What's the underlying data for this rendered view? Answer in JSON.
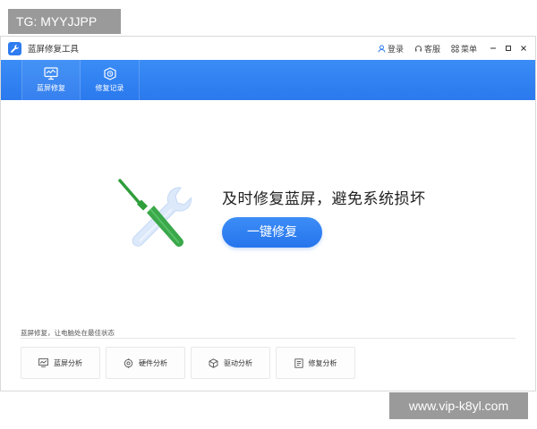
{
  "watermarks": {
    "top": "TG: MYYJJPP",
    "bottom": "www.vip-k8yl.com"
  },
  "app": {
    "title": "蓝屏修复工具",
    "login": "登录",
    "service": "客服",
    "menu": "菜单"
  },
  "nav": {
    "tabs": [
      {
        "label": "蓝屏修复",
        "icon": "monitor-icon"
      },
      {
        "label": "修复记录",
        "icon": "record-icon"
      }
    ]
  },
  "hero": {
    "headline": "及时修复蓝屏，避免系统损坏",
    "button": "一键修复"
  },
  "footer": {
    "label": "蓝屏修复，让电脑处在最佳状态",
    "cards": [
      {
        "label": "蓝屏分析",
        "icon": "chart-icon"
      },
      {
        "label": "硬件分析",
        "icon": "hardware-icon"
      },
      {
        "label": "驱动分析",
        "icon": "driver-icon"
      },
      {
        "label": "修复分析",
        "icon": "repair-icon"
      }
    ]
  },
  "colors": {
    "accent": "#2f7cf0",
    "wrench": "#d6e6fb",
    "screwdriver_handle": "#2f9e3b"
  }
}
